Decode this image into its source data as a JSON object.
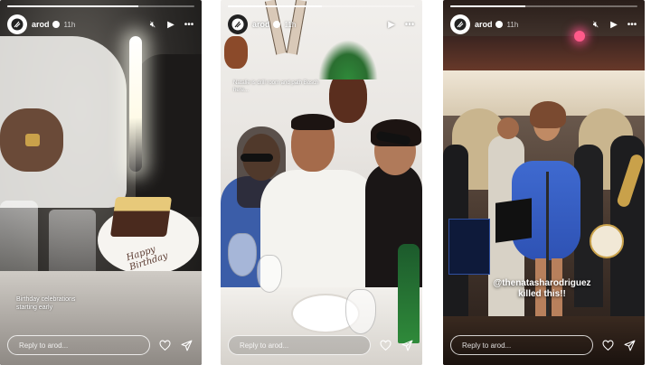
{
  "stories": [
    {
      "username": "arod",
      "time": "11h",
      "caption": "Birthday celebrations starting early",
      "cake_text": "Happy Birthday",
      "reply_placeholder": "Reply to arod...",
      "progress": 0.7
    },
    {
      "username": "arod",
      "time": "11h",
      "caption": "Natalie is drill room and path Bosch here...",
      "reply_placeholder": "Reply to arod...",
      "progress": 0.5
    },
    {
      "username": "arod",
      "time": "11h",
      "caption": "@thenatasharodriguez killed this!!",
      "reply_placeholder": "Reply to arod...",
      "progress": 0.4
    }
  ],
  "icons": {
    "mute": "speaker-muted-icon",
    "play": "play-icon",
    "more": "more-options-icon",
    "like": "heart-icon",
    "share": "send-icon"
  }
}
